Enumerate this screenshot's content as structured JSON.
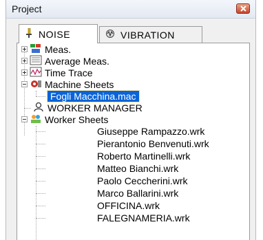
{
  "title": "Project",
  "tabs": [
    {
      "label": "NOISE",
      "active": true,
      "icon": "noise-icon"
    },
    {
      "label": "VIBRATION",
      "active": false,
      "icon": "vibration-icon"
    }
  ],
  "tree": {
    "top_items": [
      {
        "label": "Meas.",
        "icon": "meas-icon",
        "expanded": false
      },
      {
        "label": "Average Meas.",
        "icon": "average-meas-icon",
        "expanded": false
      },
      {
        "label": "Time Trace",
        "icon": "time-trace-icon",
        "expanded": false
      },
      {
        "label": "Machine Sheets",
        "icon": "machine-sheets-icon",
        "expanded": true
      }
    ],
    "machine_children": [
      {
        "label": "Fogli Macchina.mac",
        "selected": true
      }
    ],
    "worker_manager": {
      "label": "WORKER MANAGER",
      "icon": "worker-manager-icon"
    },
    "worker_sheets": {
      "label": "Worker Sheets",
      "icon": "worker-sheets-icon",
      "expanded": true
    },
    "worker_children": [
      {
        "label": "Giuseppe Rampazzo.wrk"
      },
      {
        "label": "Pierantonio Benvenuti.wrk"
      },
      {
        "label": "Roberto Martinelli.wrk"
      },
      {
        "label": "Matteo Bianchi.wrk"
      },
      {
        "label": "Paolo Ceccherini.wrk"
      },
      {
        "label": "Marco Ballarini.wrk"
      },
      {
        "label": "OFFICINA.wrk"
      },
      {
        "label": "FALEGNAMERIA.wrk"
      }
    ]
  },
  "colors": {
    "selection": "#0a64d8",
    "close_button": "#c6452b"
  }
}
